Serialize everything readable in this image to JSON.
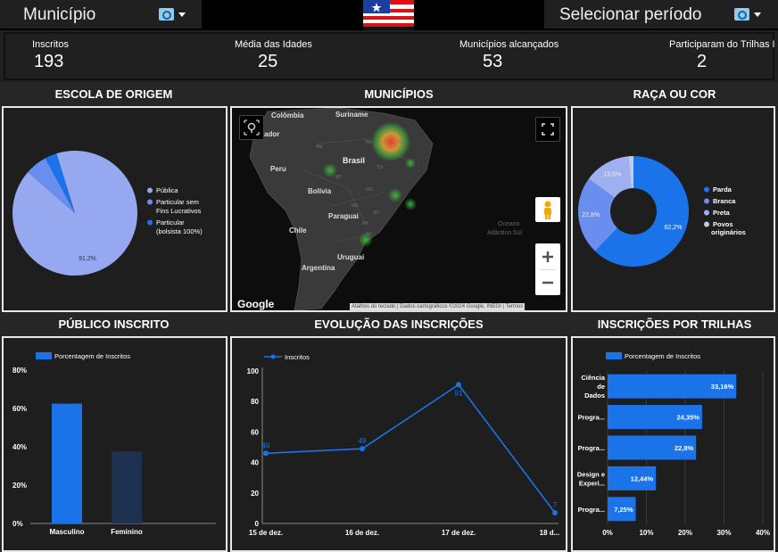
{
  "header": {
    "municipio_label": "Município",
    "periodo_label": "Selecionar período"
  },
  "kpis": [
    {
      "label": "Inscritos",
      "value": "193"
    },
    {
      "label": "Média das Idades",
      "value": "25"
    },
    {
      "label": "Municípios alcançados",
      "value": "53"
    },
    {
      "label": "Participaram do Trilhas I",
      "value": "2"
    }
  ],
  "sections": {
    "escola": "ESCOLA DE ORIGEM",
    "municipios": "MUNICÍPIOS",
    "raca": "RAÇA OU COR",
    "publico": "PÚBLICO INSCRITO",
    "evolucao": "EVOLUÇÃO DAS INSCRIÇÕES",
    "trilhas": "INSCRIÇÕES POR TRILHAS"
  },
  "colors": {
    "blue": "#1a73e8",
    "light": "#95a8f0",
    "mid": "#6a8ef0",
    "navy": "#1f3150",
    "lavender": "#b7bde8"
  },
  "map": {
    "labels": [
      "Colômbia",
      "Suriname",
      "ador",
      "Peru",
      "Brasil",
      "Bolívia",
      "Paraguai",
      "Chile",
      "Uruguai",
      "Argentina",
      "Oceano",
      "Atlântico Sul",
      "AM",
      "PA",
      "MA",
      "TO",
      "MT",
      "GO",
      "MS",
      "SP",
      "PR",
      "SC"
    ],
    "attribution": [
      "Atalhos do teclado",
      "Dados cartográficos ©2024 Google, INEGI",
      "Termos"
    ],
    "google": "Google"
  },
  "chart_data": [
    {
      "type": "pie",
      "name": "escola",
      "labels": [
        "Pública",
        "Particular sem Fins Lucrativos",
        "Particular (bolsista 100%)"
      ],
      "legend_lines": [
        [
          "Pública"
        ],
        [
          "Particular sem",
          "Fins Lucrativos"
        ],
        [
          "Particular",
          "(bolsista 100%)"
        ]
      ],
      "values": [
        91.2,
        5.7,
        3.1
      ],
      "colors": [
        "#95a8f0",
        "#6a8ef0",
        "#1a73e8"
      ],
      "data_labels": [
        "91,2%"
      ]
    },
    {
      "type": "pie",
      "name": "raca",
      "labels": [
        "Parda",
        "Branca",
        "Preta",
        "Povos originários"
      ],
      "legend_lines": [
        [
          "Parda"
        ],
        [
          "Branca"
        ],
        [
          "Preta"
        ],
        [
          "Povos",
          "originários"
        ]
      ],
      "values": [
        62.2,
        22.8,
        13.5,
        1.5
      ],
      "colors": [
        "#1a73e8",
        "#6a8ef0",
        "#9fb0f0",
        "#c4c9ea"
      ],
      "data_labels": [
        "62,2%",
        "22,8%",
        "13,5%"
      ]
    },
    {
      "type": "bar",
      "name": "publico",
      "legend": "Porcentagem de Inscritos",
      "categories": [
        "Masculino",
        "Feminino"
      ],
      "values": [
        62.5,
        37.5
      ],
      "colors": [
        "#1a73e8",
        "#1f3150"
      ],
      "yticks": [
        "0%",
        "20%",
        "40%",
        "60%",
        "80%"
      ],
      "ylim": [
        0,
        80
      ]
    },
    {
      "type": "line",
      "name": "evolucao",
      "legend": "Inscritos",
      "x": [
        "15 de dez.",
        "16 de dez.",
        "17 de dez.",
        "18 d..."
      ],
      "values": [
        46,
        49,
        91,
        7
      ],
      "yticks": [
        "0",
        "20",
        "40",
        "60",
        "80",
        "100"
      ],
      "ylim": [
        0,
        100
      ]
    },
    {
      "type": "bar",
      "orientation": "horizontal",
      "name": "trilhas",
      "legend": "Porcentagem de Inscritos",
      "categories": [
        [
          "Ciência",
          "de",
          "Dados"
        ],
        [
          "Progra..."
        ],
        [
          "Progra..."
        ],
        [
          "Design e",
          "Experi..."
        ],
        [
          "Progra..."
        ]
      ],
      "values": [
        33.16,
        24.35,
        22.8,
        12.44,
        7.25
      ],
      "data_labels": [
        "33,16%",
        "24,35%",
        "22,8%",
        "12,44%",
        "7,25%"
      ],
      "xticks": [
        "0%",
        "10%",
        "20%",
        "30%",
        "40%"
      ],
      "xlim": [
        0,
        40
      ]
    }
  ]
}
